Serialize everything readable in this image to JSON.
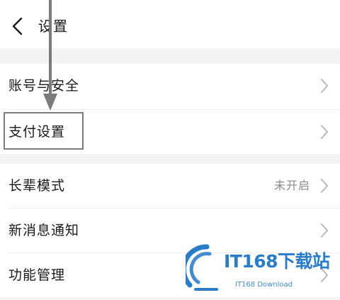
{
  "header": {
    "title": "设置",
    "back_icon": "chevron-left-icon"
  },
  "settings": {
    "items": [
      {
        "label": "账号与安全",
        "value": ""
      },
      {
        "label": "支付设置",
        "value": ""
      },
      {
        "label": "长辈模式",
        "value": "未开启"
      },
      {
        "label": "新消息通知",
        "value": ""
      },
      {
        "label": "功能管理",
        "value": ""
      }
    ]
  },
  "annotation": {
    "color": "#7b7b7b",
    "icon": "arrow-down-icon"
  },
  "watermark": {
    "text": "IT168下载站",
    "subtext": "IT168 Download",
    "color": "#1e75c8"
  },
  "colors": {
    "background": "#ffffff",
    "section_gap": "#f4f4f5",
    "text_primary": "#1a1a1a",
    "text_secondary": "#8a8a8a",
    "chevron": "#b5b5b5"
  }
}
